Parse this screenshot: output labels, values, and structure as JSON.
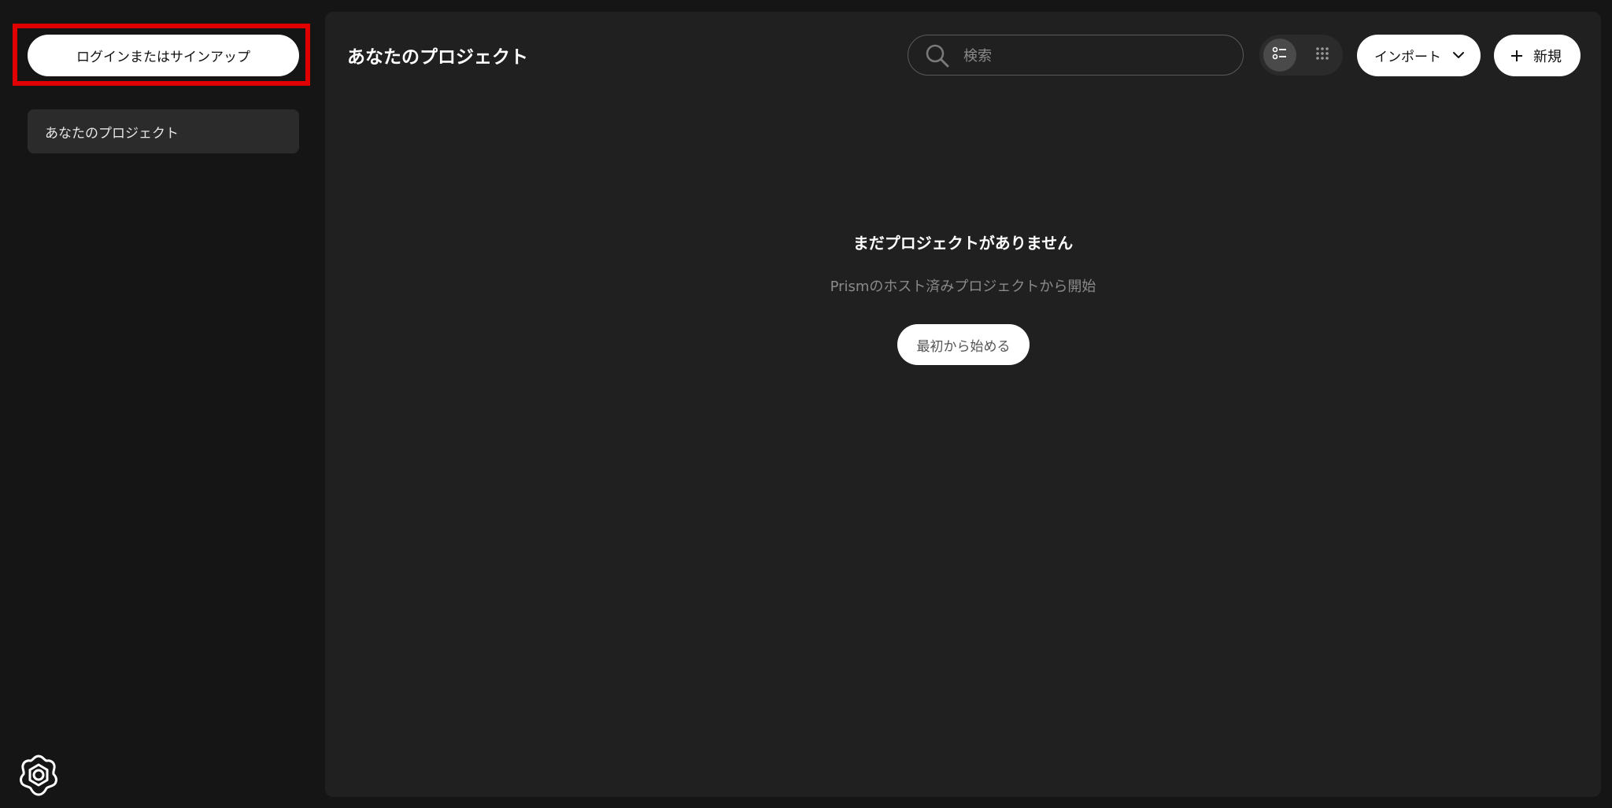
{
  "sidebar": {
    "login_label": "ログインまたはサインアップ",
    "items": [
      {
        "label": "あなたのプロジェクト"
      }
    ],
    "settings_icon": "flower-settings-icon"
  },
  "header": {
    "title": "あなたのプロジェクト",
    "search": {
      "placeholder": "検索",
      "value": ""
    },
    "view_modes": [
      "list-view-icon",
      "grid-view-icon"
    ],
    "active_view": "list",
    "import_label": "インポート",
    "new_label": "新規"
  },
  "empty_state": {
    "title": "まだプロジェクトがありません",
    "subtitle": "Prismのホスト済みプロジェクトから開始",
    "start_label": "最初から始める"
  },
  "colors": {
    "background": "#151515",
    "panel": "#202020",
    "highlight": "#e00000",
    "button": "#ffffff"
  }
}
